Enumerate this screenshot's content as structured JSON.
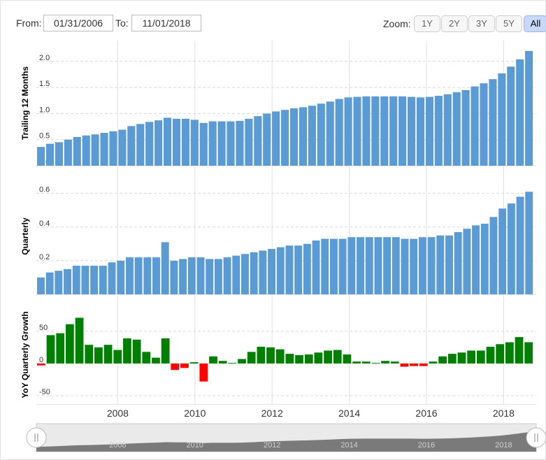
{
  "range": {
    "from_label": "From:",
    "from_value": "01/31/2006",
    "to_label": "To:",
    "to_value": "11/01/2018"
  },
  "zoom": {
    "label": "Zoom:",
    "buttons": [
      "1Y",
      "2Y",
      "3Y",
      "5Y",
      "All"
    ],
    "active": "All"
  },
  "navigator": {
    "labels": [
      "2008",
      "2010",
      "2012",
      "2014",
      "2016",
      "2018"
    ],
    "left_handle_icon": "grip-icon",
    "right_handle_icon": "grip-icon"
  },
  "colors": {
    "bar": "#5b9bd5",
    "positive": "#008000",
    "negative": "#ff0000",
    "grid": "#e0e0e0"
  },
  "chart_data": [
    {
      "type": "bar",
      "ylabel": "Trailing 12 Months",
      "ylim": [
        0,
        2.4
      ],
      "yticks": [
        0.0,
        0.5,
        1.0,
        1.5,
        2.0
      ],
      "ytick_labels": [
        "0.0",
        "0.5",
        "1.0",
        "1.5",
        "2.0"
      ],
      "x": [
        "2006-01",
        "2006-04",
        "2006-07",
        "2006-10",
        "2007-01",
        "2007-04",
        "2007-07",
        "2007-10",
        "2008-01",
        "2008-04",
        "2008-07",
        "2008-10",
        "2009-01",
        "2009-04",
        "2009-07",
        "2009-10",
        "2010-01",
        "2010-04",
        "2010-07",
        "2010-10",
        "2011-01",
        "2011-04",
        "2011-07",
        "2011-10",
        "2012-01",
        "2012-04",
        "2012-07",
        "2012-10",
        "2013-01",
        "2013-04",
        "2013-07",
        "2013-10",
        "2014-01",
        "2014-04",
        "2014-07",
        "2014-10",
        "2015-01",
        "2015-04",
        "2015-07",
        "2015-10",
        "2016-01",
        "2016-04",
        "2016-07",
        "2016-10",
        "2017-01",
        "2017-04",
        "2017-07",
        "2017-10",
        "2018-01",
        "2018-04",
        "2018-07",
        "2018-10"
      ],
      "values": [
        0.36,
        0.42,
        0.45,
        0.5,
        0.55,
        0.58,
        0.6,
        0.63,
        0.66,
        0.69,
        0.76,
        0.8,
        0.84,
        0.87,
        0.92,
        0.9,
        0.9,
        0.88,
        0.82,
        0.85,
        0.85,
        0.85,
        0.86,
        0.9,
        0.95,
        1.0,
        1.04,
        1.07,
        1.1,
        1.12,
        1.15,
        1.19,
        1.23,
        1.28,
        1.31,
        1.32,
        1.33,
        1.33,
        1.33,
        1.33,
        1.33,
        1.32,
        1.31,
        1.32,
        1.34,
        1.37,
        1.41,
        1.45,
        1.52,
        1.58,
        1.66,
        1.77,
        1.9,
        2.04,
        2.2
      ]
    },
    {
      "type": "bar",
      "ylabel": "Quarterly",
      "ylim": [
        0,
        0.69
      ],
      "yticks": [
        0.0,
        0.2,
        0.4,
        0.6
      ],
      "ytick_labels": [
        "0.0",
        "0.2",
        "0.4",
        "0.6"
      ],
      "values": [
        0.1,
        0.13,
        0.14,
        0.15,
        0.17,
        0.17,
        0.17,
        0.17,
        0.19,
        0.2,
        0.22,
        0.22,
        0.22,
        0.22,
        0.31,
        0.2,
        0.21,
        0.22,
        0.22,
        0.21,
        0.21,
        0.22,
        0.23,
        0.24,
        0.25,
        0.26,
        0.27,
        0.28,
        0.29,
        0.29,
        0.3,
        0.32,
        0.33,
        0.33,
        0.33,
        0.34,
        0.34,
        0.34,
        0.34,
        0.34,
        0.34,
        0.33,
        0.33,
        0.34,
        0.34,
        0.35,
        0.35,
        0.37,
        0.39,
        0.41,
        0.42,
        0.46,
        0.51,
        0.54,
        0.58,
        0.61
      ]
    },
    {
      "type": "bar",
      "ylabel": "YoY Quarterly Growth",
      "ylim": [
        -63,
        90
      ],
      "yticks": [
        -50,
        0,
        50
      ],
      "ytick_labels": [
        "-50",
        "0",
        "50"
      ],
      "values": [
        -3,
        44,
        47,
        61,
        71,
        29,
        25,
        29,
        21,
        39,
        37,
        18,
        9,
        39,
        -10,
        -7,
        2,
        -28,
        11,
        4,
        1,
        7,
        18,
        26,
        25,
        22,
        15,
        13,
        14,
        17,
        20,
        21,
        14,
        3,
        3,
        1,
        4,
        3,
        -5,
        -4,
        -4,
        3,
        11,
        15,
        17,
        20,
        20,
        26,
        30,
        33,
        41,
        33
      ]
    }
  ],
  "x_axis": {
    "ticks": [
      "2008",
      "2010",
      "2012",
      "2014",
      "2016",
      "2018"
    ]
  }
}
